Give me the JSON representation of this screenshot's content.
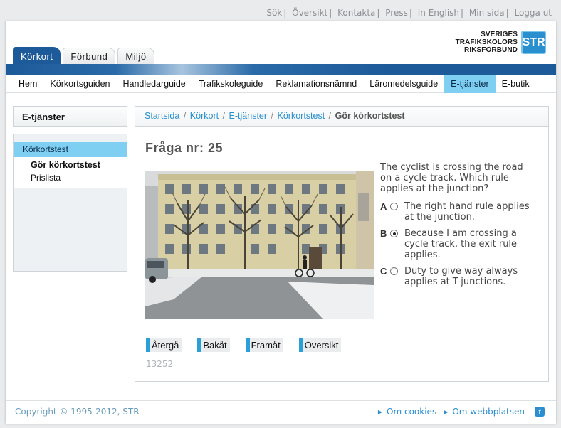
{
  "toplinks": [
    "Sök",
    "Översikt",
    "Kontakta",
    "Press",
    "In English",
    "Min sida",
    "Logga ut"
  ],
  "toplinks_separator": "|",
  "logo": {
    "lines": [
      "SVERIGES",
      "TRAFIKSKOLORS",
      "RIKSFÖRBUND"
    ],
    "badge": "STR"
  },
  "tabs": [
    {
      "label": "Körkort",
      "active": true
    },
    {
      "label": "Förbund",
      "active": false
    },
    {
      "label": "Miljö",
      "active": false
    }
  ],
  "mainnav": [
    {
      "label": "Hem",
      "active": false
    },
    {
      "label": "Körkortsguiden",
      "active": false
    },
    {
      "label": "Handledarguide",
      "active": false
    },
    {
      "label": "Trafikskoleguide",
      "active": false
    },
    {
      "label": "Reklamationsnämnd",
      "active": false
    },
    {
      "label": "Läromedelsguide",
      "active": false
    },
    {
      "label": "E-tjänster",
      "active": true
    },
    {
      "label": "E-butik",
      "active": false
    }
  ],
  "sidebar": {
    "title": "E-tjänster",
    "section": "Körkortstest",
    "items": [
      {
        "label": "Gör körkortstest",
        "current": true
      },
      {
        "label": "Prislista",
        "current": false
      }
    ]
  },
  "breadcrumb": {
    "links": [
      "Startsida",
      "Körkort",
      "E-tjänster",
      "Körkortstest"
    ],
    "current": "Gör körkortstest",
    "separator": "/"
  },
  "quiz": {
    "title": "Fråga nr: 25",
    "question": "The cyclist is crossing the road on a cycle track. Which rule applies at the junction?",
    "answers": [
      {
        "letter": "A",
        "text": "The right hand rule applies at the junction.",
        "selected": false
      },
      {
        "letter": "B",
        "text": "Because I am crossing a cycle track, the exit rule applies.",
        "selected": true
      },
      {
        "letter": "C",
        "text": "Duty to give way always applies at T-junctions.",
        "selected": false
      }
    ],
    "buttons": [
      "Återgå",
      "Bakåt",
      "Framåt",
      "Översikt"
    ],
    "code": "13252"
  },
  "footer": {
    "copyright": "Copyright © 1995-2012, STR",
    "links": [
      "Om cookies",
      "Om webbplatsen"
    ],
    "icon": "facebook-icon"
  },
  "colors": {
    "brand_blue": "#1d5a99",
    "accent_cyan": "#7ecff2",
    "link_blue": "#2a8fcf"
  }
}
